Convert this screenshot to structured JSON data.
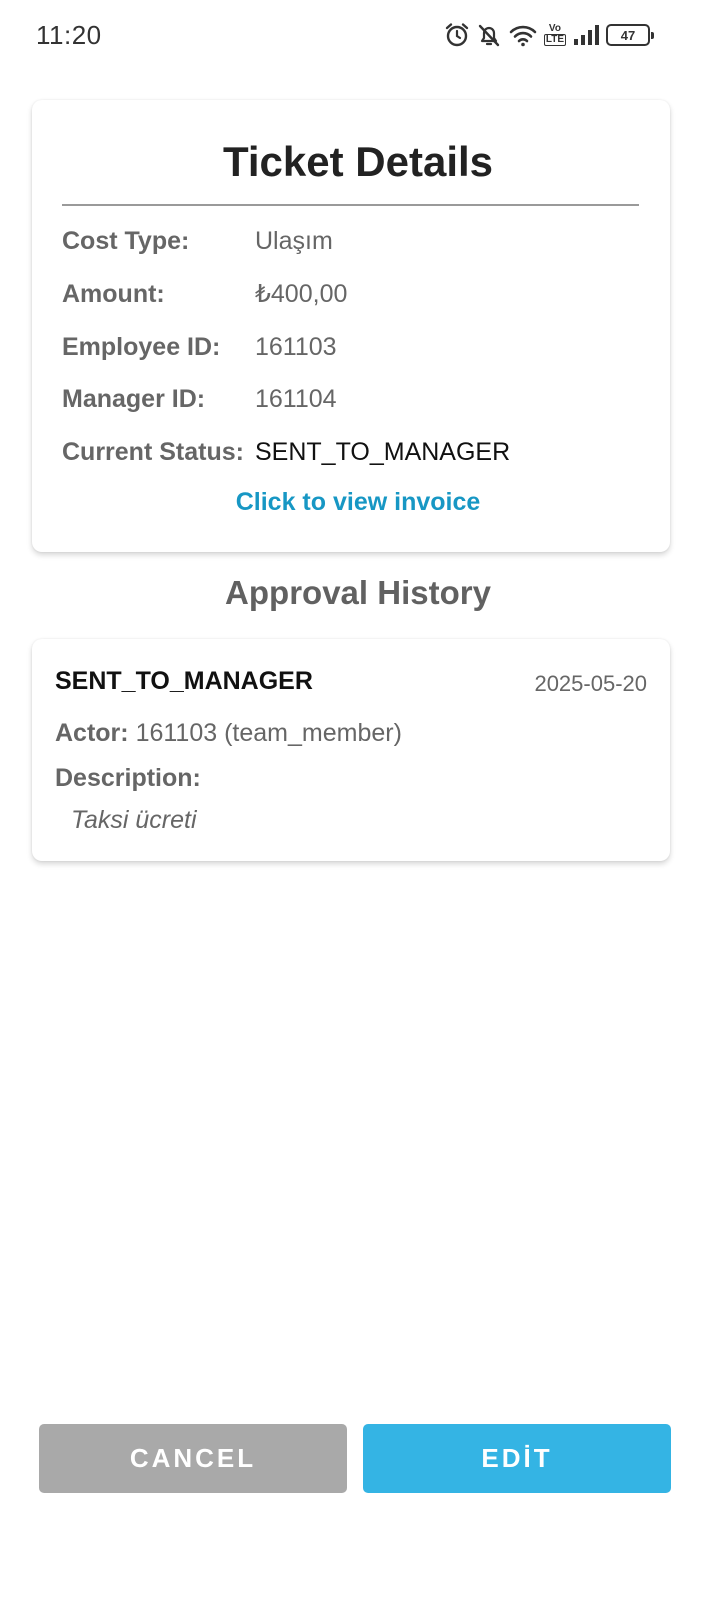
{
  "status_bar": {
    "time": "11:20",
    "icons": [
      "alarm-icon",
      "notifications-off-icon",
      "wifi-icon",
      "volte-icon",
      "signal-icon",
      "battery-icon"
    ],
    "volte_top": "Vo",
    "volte_bottom": "LTE",
    "battery_level": "47"
  },
  "ticket": {
    "title": "Ticket Details",
    "rows": [
      {
        "label": "Cost Type:",
        "value": "Ulaşım"
      },
      {
        "label": "Amount:",
        "value": "₺400,00"
      },
      {
        "label": "Employee ID:",
        "value": "161103"
      },
      {
        "label": "Manager ID:",
        "value": "161104"
      },
      {
        "label": "Current Status:",
        "value": "SENT_TO_MANAGER"
      }
    ],
    "invoice_link": "Click to view invoice",
    "link_color": "#1797c4"
  },
  "history": {
    "title": "Approval History",
    "entries": [
      {
        "status": "SENT_TO_MANAGER",
        "date": "2025-05-20",
        "actor_label": "Actor:",
        "actor_value": "161103 (team_member)",
        "description_label": "Description:",
        "description": "Taksi ücreti"
      }
    ]
  },
  "actions": {
    "cancel_label": "CANCEL",
    "edit_label": "EDİT",
    "cancel_color": "#a9a9a9",
    "edit_color": "#34b4e4"
  }
}
